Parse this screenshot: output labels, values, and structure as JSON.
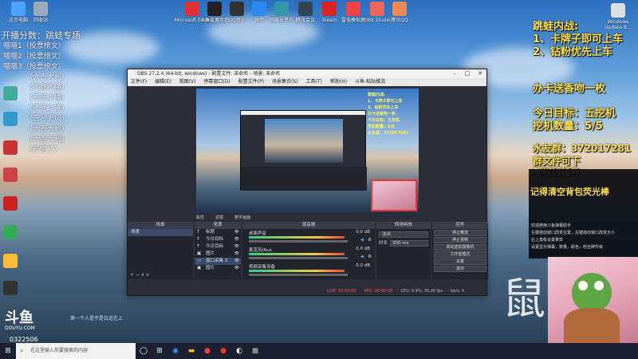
{
  "desktop_icons": [
    {
      "label": "这台电脑"
    },
    {
      "label": "回收站"
    },
    {
      "label": "Microsoft Edge"
    },
    {
      "label": "斗鱼直播伴侣"
    },
    {
      "label": "QQ音乐"
    },
    {
      "label": "微信"
    },
    {
      "label": "网易云音乐"
    },
    {
      "label": "腾讯会议"
    },
    {
      "label": "Steam"
    },
    {
      "label": "雷电模拟器"
    },
    {
      "label": "OBS Studio"
    },
    {
      "label": "腾讯QQ"
    }
  ],
  "recycle_label": "Windows Update B...",
  "left_overlay": {
    "line1": "开播分数：跳蛙专场",
    "lines": [
      "喵喵1（投票榜文）",
      "喵喵2（投票榜文）",
      "喵喵3（投票榜文）",
      "（大吉大利）",
      "（不死不播）",
      "（不死少播）",
      "（不死少播）",
      "（三月无风）",
      "（大吉大利）",
      "（大吉大利）",
      "（开学了）"
    ],
    "bottom_text": "0322506",
    "ad_text": "第一个人是不是白送在上"
  },
  "obs": {
    "title": "OBS 27.2.4 (64-bit, windows) - 配置文件: 未命名 - 场景: 未命名",
    "menu": [
      "文件(F)",
      "编辑(E)",
      "视图(V)",
      "停靠窗口(D)",
      "配置文件(P)",
      "场景集合(S)",
      "工具(T)",
      "帮助(H)",
      "斗鱼-粘贴推流"
    ],
    "source_toolbar": [
      "属性",
      "滤镜",
      "数字画面"
    ],
    "panels": {
      "scenes": {
        "title": "场景",
        "items": [
          "场景"
        ]
      },
      "sources": {
        "title": "来源",
        "items": [
          "标题",
          "今日目标",
          "今日目标",
          "图片",
          "窗口采集 2",
          "图片"
        ]
      },
      "mixer": {
        "title": "混音器",
        "channels": [
          {
            "name": "桌面声音",
            "db": "0.0 dB"
          },
          {
            "name": "麦克风/Aux",
            "db": "0.0 dB"
          },
          {
            "name": "视频采集设备",
            "db": "0.0 dB"
          }
        ]
      },
      "transitions": {
        "title": "转场特效",
        "type": "淡出",
        "duration_label": "时长",
        "duration": "300 ms"
      },
      "controls": {
        "title": "控件",
        "buttons": [
          "停止推流",
          "停止录制",
          "启动虚拟摄像机",
          "工作室模式",
          "设置",
          "退出"
        ]
      }
    },
    "status": [
      "LIVE: 00:00:00",
      "REC: 00:00:00",
      "CPU: 0.9%, 30.00 fps",
      "kb/s: 0"
    ]
  },
  "right_overlay": {
    "title1": "跳蛙内战:",
    "rule1": "1、卡牌子即可上车",
    "rule2": "2、钻粉优先上车",
    "gift": "办卡送香吻一枚",
    "goal": "今日目标：五挖机",
    "count": "挖机数量：5/5",
    "group": "水友群：372017281",
    "file": "群文件可下",
    "plugin": "载拔线插件",
    "reminder": "记得清空背包荧光棒"
  },
  "chat": {
    "lines": [
      "欢迎使用斗鱼弹幕助手",
      "左键拖动窗口改变位置，左键拖动窗口改变大小",
      "右上角有设置菜单",
      "设置显示弹幕，数量，颜色，粉丝牌升级"
    ]
  },
  "watermark": "鼠",
  "taskbar": {
    "search_placeholder": "在这里输入你要搜索的内容",
    "logo_text": "斗鱼",
    "logo_sub": "DOUYU.COM"
  },
  "colors": {
    "accent": "#f5c518",
    "live_red": "#ff3a3a",
    "obs_bg": "#2b2e38",
    "panel_bg": "#22252e"
  }
}
